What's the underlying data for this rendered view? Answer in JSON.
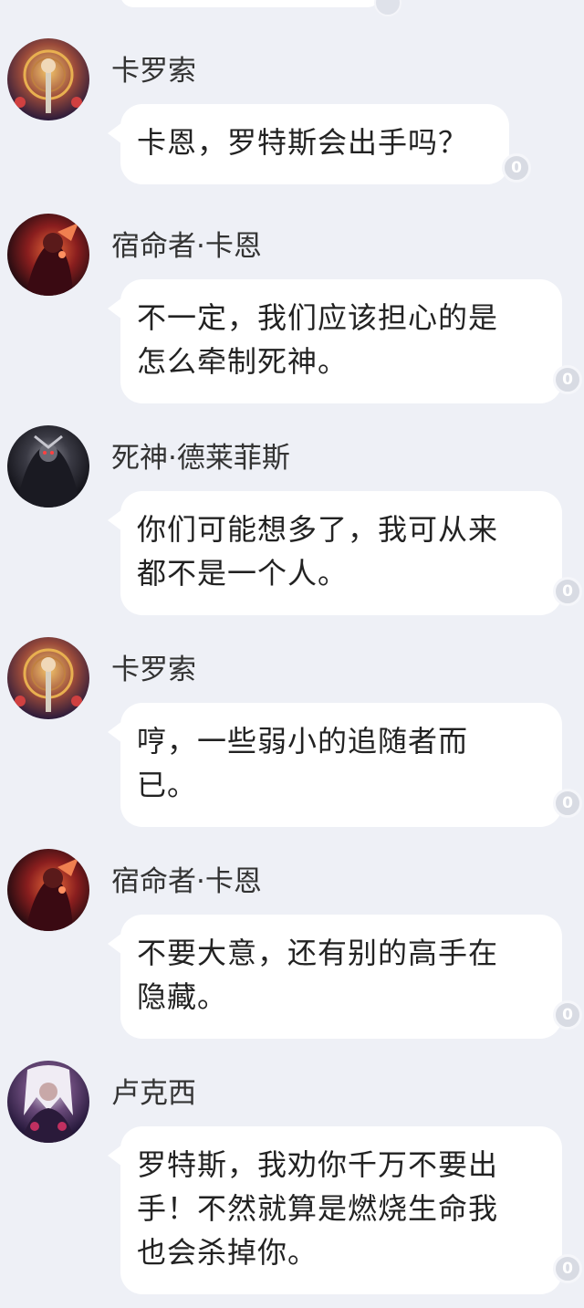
{
  "messages": [
    {
      "sender": "卡罗索",
      "avatar_icon": "golden-warrior-avatar-icon",
      "lines": [
        "卡恩，罗特斯会出手吗？"
      ],
      "reply_count": "0"
    },
    {
      "sender": "宿命者·卡恩",
      "avatar_icon": "crimson-fate-avatar-icon",
      "lines": [
        "不一定，我们应该担心的是",
        "怎么牵制死神。"
      ],
      "reply_count": "0"
    },
    {
      "sender": "死神·德莱菲斯",
      "avatar_icon": "dark-reaper-avatar-icon",
      "lines": [
        "你们可能想多了，我可从来",
        "都不是一个人。"
      ],
      "reply_count": "0"
    },
    {
      "sender": "卡罗索",
      "avatar_icon": "golden-warrior-avatar-icon",
      "lines": [
        "哼，一些弱小的追随者而",
        "已。"
      ],
      "reply_count": "0"
    },
    {
      "sender": "宿命者·卡恩",
      "avatar_icon": "crimson-fate-avatar-icon",
      "lines": [
        "不要大意，还有别的高手在",
        "隐藏。"
      ],
      "reply_count": "0"
    },
    {
      "sender": "卢克西",
      "avatar_icon": "silver-hair-avatar-icon",
      "lines": [
        "罗特斯，我劝你千万不要出",
        "手！不然就算是燃烧生命我",
        "也会杀掉你。"
      ],
      "reply_count": "0"
    }
  ],
  "colors": {
    "background": "#eef0f6",
    "bubble": "#ffffff",
    "badge": "#d8dbe3"
  }
}
